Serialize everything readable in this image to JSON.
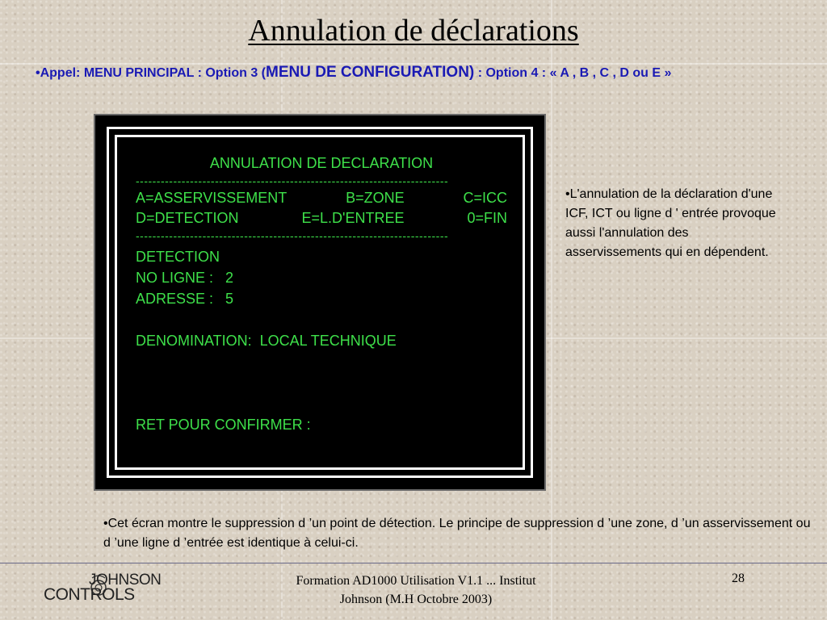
{
  "slide": {
    "title": "Annulation de déclarations",
    "appel": {
      "part1": "•Appel: MENU PRINCIPAL : Option 3 (",
      "part2": "MENU DE CONFIGURATION)",
      "part3": " : Option 4 : « A , B , C , D ou E »"
    },
    "terminal": {
      "heading": "ANNULATION  DE DECLARATION",
      "separator": "---------------------------------------------------------------------------",
      "menu_row1": [
        "A=ASSERVISSEMENT",
        "B=ZONE",
        "C=ICC"
      ],
      "menu_row2": [
        "D=DETECTION",
        "E=L.D'ENTREE",
        "0=FIN"
      ],
      "type_line": "DETECTION",
      "no_ligne": "NO LIGNE :   2",
      "adresse": "ADRESSE :   5",
      "denomination": "DENOMINATION:  LOCAL TECHNIQUE",
      "prompt": "RET POUR CONFIRMER :"
    },
    "note_right": "•L'annulation de la déclaration d'une ICF, ICT ou ligne d ' entrée provoque aussi l'annulation des asservissements qui en dépendent.",
    "note_bottom": "•Cet écran montre le suppression d ’un point de détection. Le principe de suppression d ’une zone, d ’un asservissement ou d ’une ligne d ’entrée est identique à celui-ci.",
    "footer": {
      "center": "Formation AD1000 Utilisation V1.1 ... Institut Johnson   (M.H Octobre 2003)",
      "page": "28",
      "logo_line1": "JOHNSON",
      "logo_line2": "CONTROLS"
    }
  },
  "colors": {
    "terminal_text": "#3ee04a",
    "appel_text": "#1a1ab4",
    "background": "#d9d0c2"
  }
}
